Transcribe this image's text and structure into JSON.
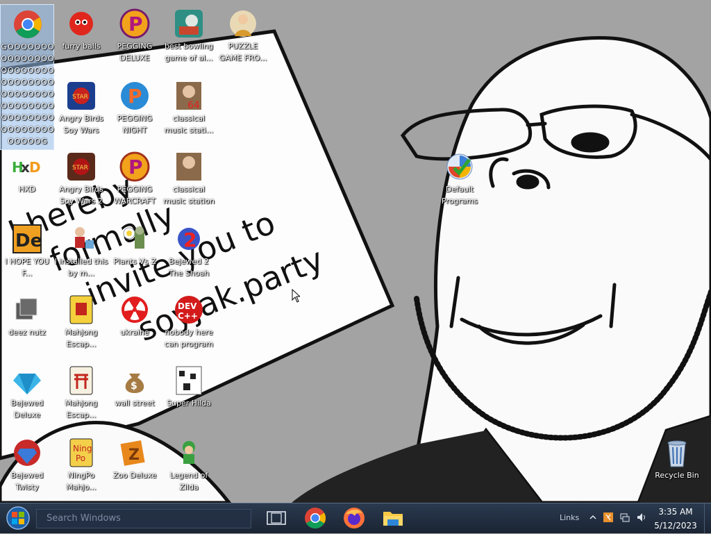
{
  "desktop": {
    "icons": [
      {
        "label": "GOOOOOOOOOOOOOOOOOOOOOOOOOOOOOOOOOOOOOOOOOOOOOOOOOOOOOOOOOOOOOOOOOOOOG",
        "icon": "chrome-icon",
        "selected": true
      },
      {
        "label": "furry balls",
        "icon": "furry-ball-icon"
      },
      {
        "label": "PEGGING DELUXE",
        "icon": "pegging-p-icon"
      },
      {
        "label": "best bowling game of al...",
        "icon": "bowling-icon"
      },
      {
        "label": "PUZZLE GAME FRO...",
        "icon": "puzzle-icon"
      },
      {
        "label": "Angry Birds Soy Wars",
        "icon": "angry-birds-icon"
      },
      {
        "label": "PEGGING NIGHT",
        "icon": "pegging-night-icon"
      },
      {
        "label": "classical music stati...",
        "icon": "classical-music-icon"
      },
      {
        "label": "HXD",
        "icon": "hxd-icon"
      },
      {
        "label": "Angry Birds Soy Wars 2",
        "icon": "angry-birds-2-icon"
      },
      {
        "label": "PEGGING WARCRAFT",
        "icon": "pegging-warcraft-icon"
      },
      {
        "label": "classical music station",
        "icon": "classical-music-2-icon"
      },
      {
        "label": "I HOPE YOU F...",
        "icon": "de-icon"
      },
      {
        "label": "I installed this by m...",
        "icon": "installer-icon"
      },
      {
        "label": "Plants Vs Z",
        "icon": "plants-icon"
      },
      {
        "label": "Bejewed 2 The Shoah",
        "icon": "bejewed-2-icon"
      },
      {
        "label": "deez nutz",
        "icon": "windows-stack-icon"
      },
      {
        "label": "Mahjong Escap...",
        "icon": "mahjong-icon"
      },
      {
        "label": "ukraine",
        "icon": "radiation-icon"
      },
      {
        "label": "nobody here can program",
        "icon": "devcpp-icon"
      },
      {
        "label": "Bejewed Deluxe",
        "icon": "diamond-icon"
      },
      {
        "label": "Mahjong Escap...",
        "icon": "mahjong-2-icon"
      },
      {
        "label": "wall street",
        "icon": "money-bag-icon"
      },
      {
        "label": "Super Hilda",
        "icon": "super-hilda-icon"
      },
      {
        "label": "Bejewed Twisty",
        "icon": "bejewed-twist-icon"
      },
      {
        "label": "NingPo Mahjo...",
        "icon": "ningpo-icon"
      },
      {
        "label": "Zoo Deluxe",
        "icon": "zoo-icon"
      },
      {
        "label": "Legend of Zilda",
        "icon": "zilda-icon"
      },
      {
        "label": "Default Programs",
        "icon": "default-programs-icon"
      },
      {
        "label": "Recycle Bin",
        "icon": "recycle-bin-icon"
      }
    ]
  },
  "wallpaper": {
    "sign_text": [
      "I hereby",
      "formally",
      "invite you to",
      "soyjak.party"
    ],
    "background_color": "#a3a3a3"
  },
  "taskbar": {
    "search_placeholder": "Search Windows",
    "links_label": "Links",
    "time": "3:35 AM",
    "date": "5/12/2023",
    "pinned": [
      "task-view-icon",
      "chrome-icon",
      "firefox-icon",
      "file-explorer-icon"
    ]
  }
}
